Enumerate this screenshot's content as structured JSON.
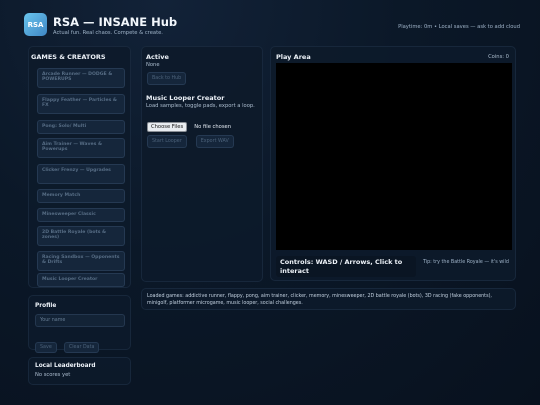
{
  "header": {
    "logo_text": "RSA",
    "title": "RSA — INSANE Hub",
    "tagline": "Actual fun. Real chaos. Compete & create.",
    "status": "Playtime: 0m • Local saves — ask to add cloud"
  },
  "sidebar": {
    "heading": "GAMES & CREATORS",
    "games": [
      {
        "label": "Arcade Runner — DODGE & POWERUPS"
      },
      {
        "label": "Flappy Feather — Particles & FX"
      },
      {
        "label": "Pong: Solo/ Multi"
      },
      {
        "label": "Aim Trainer — Waves & Powerups"
      },
      {
        "label": "Clicker Frenzy — Upgrades"
      },
      {
        "label": "Memory Match"
      },
      {
        "label": "Minesweeper Classic"
      },
      {
        "label": "2D Battle Royale (bots & zones)"
      },
      {
        "label": "Racing Sandbox — Opponents & Drifts"
      },
      {
        "label": "Music Looper Creator"
      }
    ]
  },
  "profile": {
    "heading": "Profile",
    "name_placeholder": "Your name",
    "save_label": "Save",
    "clear_label": "Clear Data"
  },
  "leaderboard": {
    "heading": "Local Leaderboard",
    "empty_text": "No scores yet"
  },
  "center": {
    "active_heading": "Active",
    "active_value": "None",
    "back_label": "Back to Hub",
    "creator_title": "Music Looper Creator",
    "creator_desc": "Load samples, toggle pads, export a loop.",
    "file_button": "Choose Files",
    "file_status": "No file chosen",
    "start_label": "Start Looper",
    "export_label": "Export WAV"
  },
  "play": {
    "heading": "Play Area",
    "coins": "Coins: 0",
    "controls": "Controls: WASD / Arrows, Click to interact",
    "tip": "Tip: try the Battle Royale — it's wild"
  },
  "loaded": {
    "text": "Loaded games: addictive runner, flappy, pong, aim trainer, clicker, memory, minesweeper, 2D battle royale (bots), 3D racing (fake opponents), minigolf, platformer microgame, music looper, social challenges."
  },
  "colors": {
    "background": "#0b1828",
    "panel": "#0d1a2a",
    "logo_gradient_start": "#69c5ee",
    "logo_gradient_end": "#3f86c4",
    "canvas": "#000000"
  }
}
